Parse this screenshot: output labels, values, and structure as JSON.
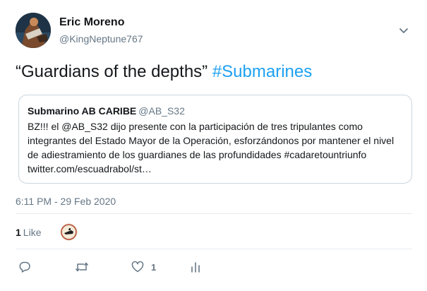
{
  "author": {
    "display_name": "Eric Moreno",
    "handle": "@KingNeptune767"
  },
  "tweet": {
    "text_prefix": "“Guardians of the depths” ",
    "hashtag": "#Submarines"
  },
  "quoted_tweet": {
    "display_name": "Submarino AB CARIBE",
    "handle": "@AB_S32",
    "lines": [
      "BZ!!! el @AB_S32 dijo presente con la participación de tres tripulantes como",
      "integrantes del Estado Mayor de la Operación, esforzándonos por mantener el nivel",
      "de adiestramiento de los guardianes de las profundidades #cadaretountriunfo",
      "twitter.com/escuadrabol/st…"
    ]
  },
  "timestamp": "6:11 PM - 29 Feb 2020",
  "likes": {
    "count": "1",
    "label": "Like"
  },
  "actions": {
    "reply_count": "",
    "retweet_count": "",
    "like_count": "1"
  },
  "colors": {
    "accent": "#1da1f2",
    "secondary_text": "#657786",
    "border": "#ccd6dd"
  },
  "icons": [
    "chevron-down-icon",
    "reply-icon",
    "retweet-icon",
    "heart-icon",
    "analytics-icon"
  ]
}
